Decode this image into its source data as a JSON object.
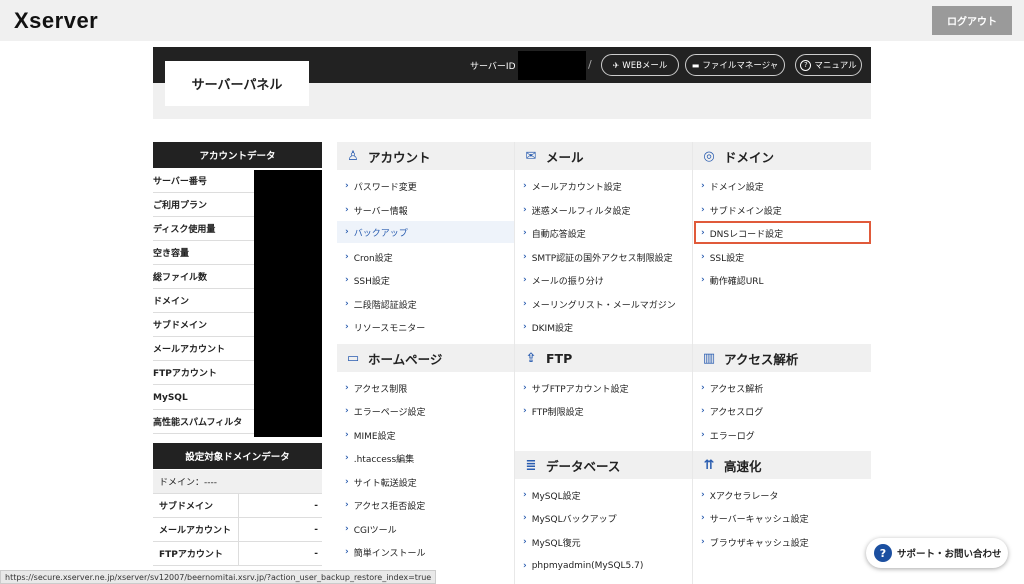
{
  "app": {
    "logo": "Xserver",
    "logout": "ログアウト"
  },
  "header": {
    "panel_title": "サーバーパネル",
    "server_id_label": "サーバーID",
    "slash": "/",
    "buttons": [
      {
        "label": "WEBメール",
        "icon": "paper-plane-icon",
        "glyph": "✈"
      },
      {
        "label": "ファイルマネージャ",
        "icon": "folder-icon",
        "glyph": "▬"
      },
      {
        "label": "マニュアル",
        "icon": "question-icon",
        "glyph": "?"
      }
    ]
  },
  "account_data": {
    "heading": "アカウントデータ",
    "rows": [
      "サーバー番号",
      "ご利用プラン",
      "ディスク使用量",
      "空き容量",
      "総ファイル数",
      "ドメイン",
      "サブドメイン",
      "メールアカウント",
      "FTPアカウント",
      "MySQL",
      "高性能スパムフィルタ"
    ]
  },
  "domain_data": {
    "heading": "設定対象ドメインデータ",
    "domain_row": "ドメイン：----",
    "rows": [
      {
        "label": "サブドメイン",
        "value": "-"
      },
      {
        "label": "メールアカウント",
        "value": "-"
      },
      {
        "label": "FTPアカウント",
        "value": "-"
      }
    ]
  },
  "menu": {
    "account": {
      "title": "アカウント",
      "icon": "person-icon",
      "items": [
        "パスワード変更",
        "サーバー情報",
        "バックアップ",
        "Cron設定",
        "SSH設定",
        "二段階認証設定",
        "リソースモニター"
      ]
    },
    "mail": {
      "title": "メール",
      "icon": "envelope-icon",
      "items": [
        "メールアカウント設定",
        "迷惑メールフィルタ設定",
        "自動応答設定",
        "SMTP認証の国外アクセス制限設定",
        "メールの振り分け",
        "メーリングリスト・メールマガジン",
        "DKIM設定"
      ]
    },
    "domain": {
      "title": "ドメイン",
      "icon": "globe-icon",
      "items": [
        "ドメイン設定",
        "サブドメイン設定",
        "DNSレコード設定",
        "SSL設定",
        "動作確認URL"
      ]
    },
    "homepage": {
      "title": "ホームページ",
      "icon": "browser-window-icon",
      "items": [
        "アクセス制限",
        "エラーページ設定",
        "MIME設定",
        ".htaccess編集",
        "サイト転送設定",
        "アクセス拒否設定",
        "CGIツール",
        "簡単インストール"
      ]
    },
    "ftp": {
      "title": "FTP",
      "icon": "upload-icon",
      "items": [
        "サブFTPアカウント設定",
        "FTP制限設定"
      ]
    },
    "analytics": {
      "title": "アクセス解析",
      "icon": "bar-chart-icon",
      "items": [
        "アクセス解析",
        "アクセスログ",
        "エラーログ"
      ]
    },
    "database": {
      "title": "データベース",
      "icon": "database-icon",
      "items": [
        "MySQL設定",
        "MySQLバックアップ",
        "MySQL復元",
        "phpmyadmin(MySQL5.7)"
      ]
    },
    "speed": {
      "title": "高速化",
      "icon": "rocket-icon",
      "items": [
        "Xアクセラレータ",
        "サーバーキャッシュ設定",
        "ブラウザキャッシュ設定"
      ]
    }
  },
  "support": {
    "label": "サポート・お問い合わせ",
    "icon": "question-circle-icon"
  },
  "status_bar": "https://secure.xserver.ne.jp/xserver/sv12007/beernomitai.xsrv.jp/?action_user_backup_restore_index=true",
  "colors": {
    "accent": "#2a5db0",
    "highlight_border": "#e05a3a",
    "header_bg": "#222222"
  }
}
